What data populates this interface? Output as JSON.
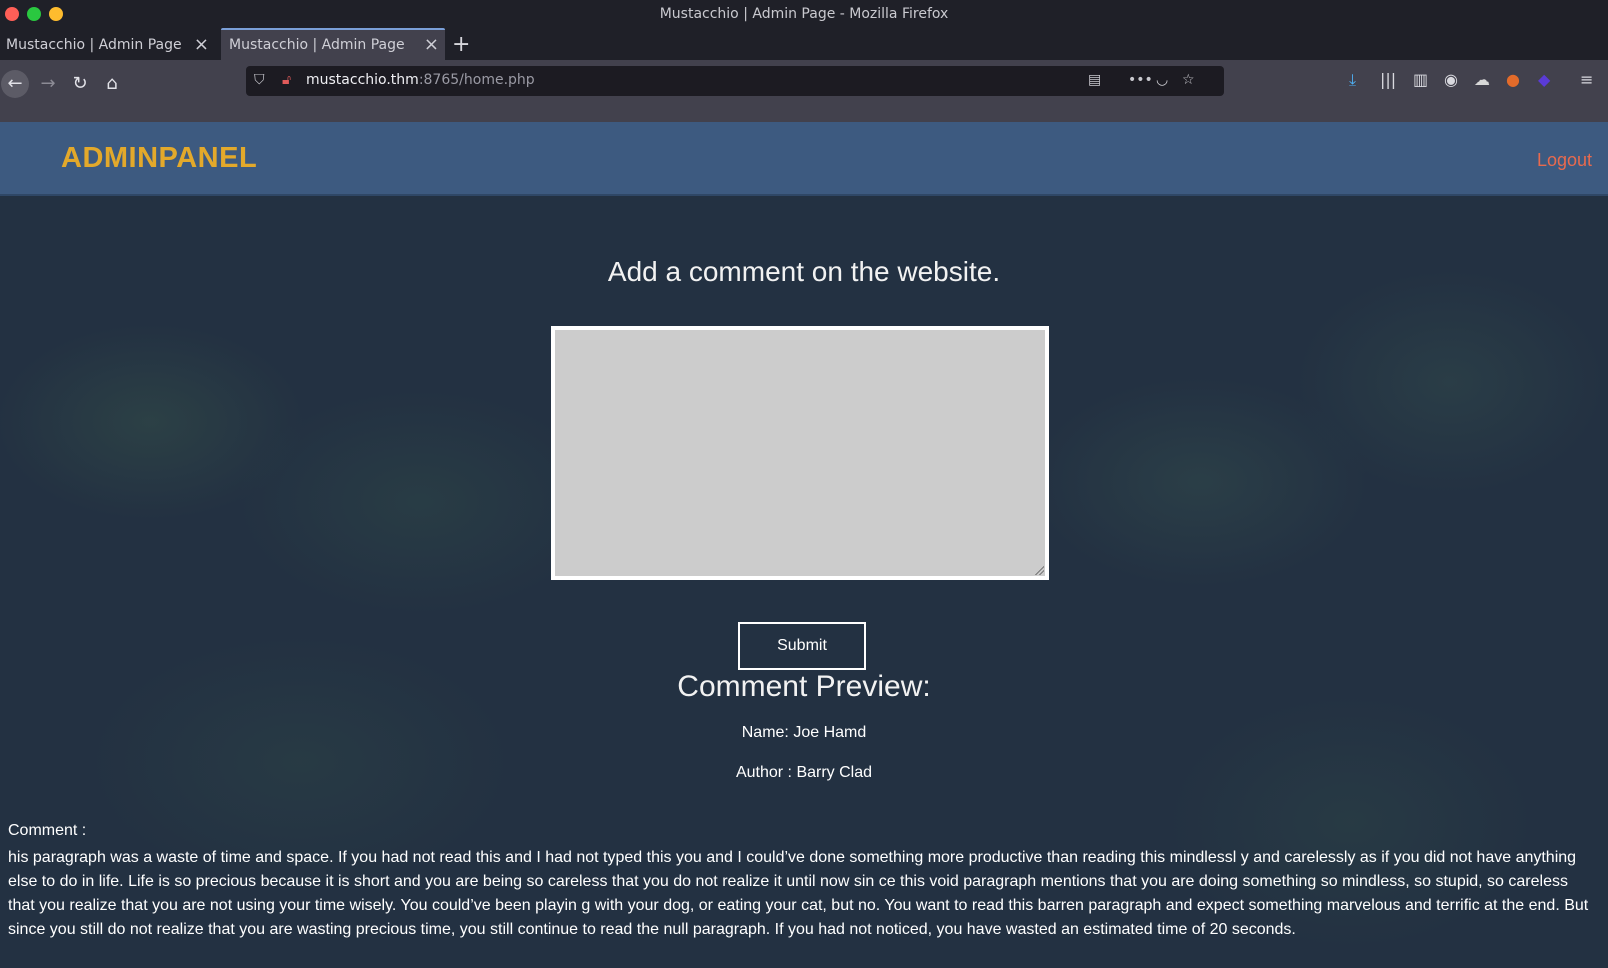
{
  "window": {
    "title": "Mustacchio | Admin Page - Mozilla Firefox"
  },
  "tabs": [
    {
      "label": "Mustacchio | Admin Page",
      "active": false
    },
    {
      "label": "Mustacchio | Admin Page",
      "active": true
    }
  ],
  "toolbar": {
    "url_host": "mustacchio.thm",
    "url_path": ":8765/home.php"
  },
  "header": {
    "brand": "ADMINPANEL",
    "logout": "Logout",
    "brand_color": "#e3a92b",
    "logout_color": "#e86a4e",
    "bar_color": "#3d5a80"
  },
  "form": {
    "heading": "Add a comment on the website.",
    "comment_value": "",
    "submit_label": "Submit"
  },
  "preview": {
    "title": "Comment Preview:",
    "name_line": "Name: Joe Hamd",
    "author_line": "Author : Barry Clad",
    "comment_label": "Comment :",
    "comment_text": "his paragraph was a waste of time and space. If you had not read this and I had not typed this you and I could’ve done something more productive than reading this mindlessl y and carelessly as if you did not have anything else to do in life. Life is so precious because it is short and you are being so careless that you do not realize it until now sin ce this void paragraph mentions that you are doing something so mindless, so stupid, so careless that you realize that you are not using your time wisely. You could’ve been playin g with your dog, or eating your cat, but no. You want to read this barren paragraph and expect something marvelous and terrific at the end. But since you still do not realize that you are wasting precious time, you still continue to read the null paragraph. If you had not noticed, you have wasted an estimated time of 20 seconds."
  }
}
